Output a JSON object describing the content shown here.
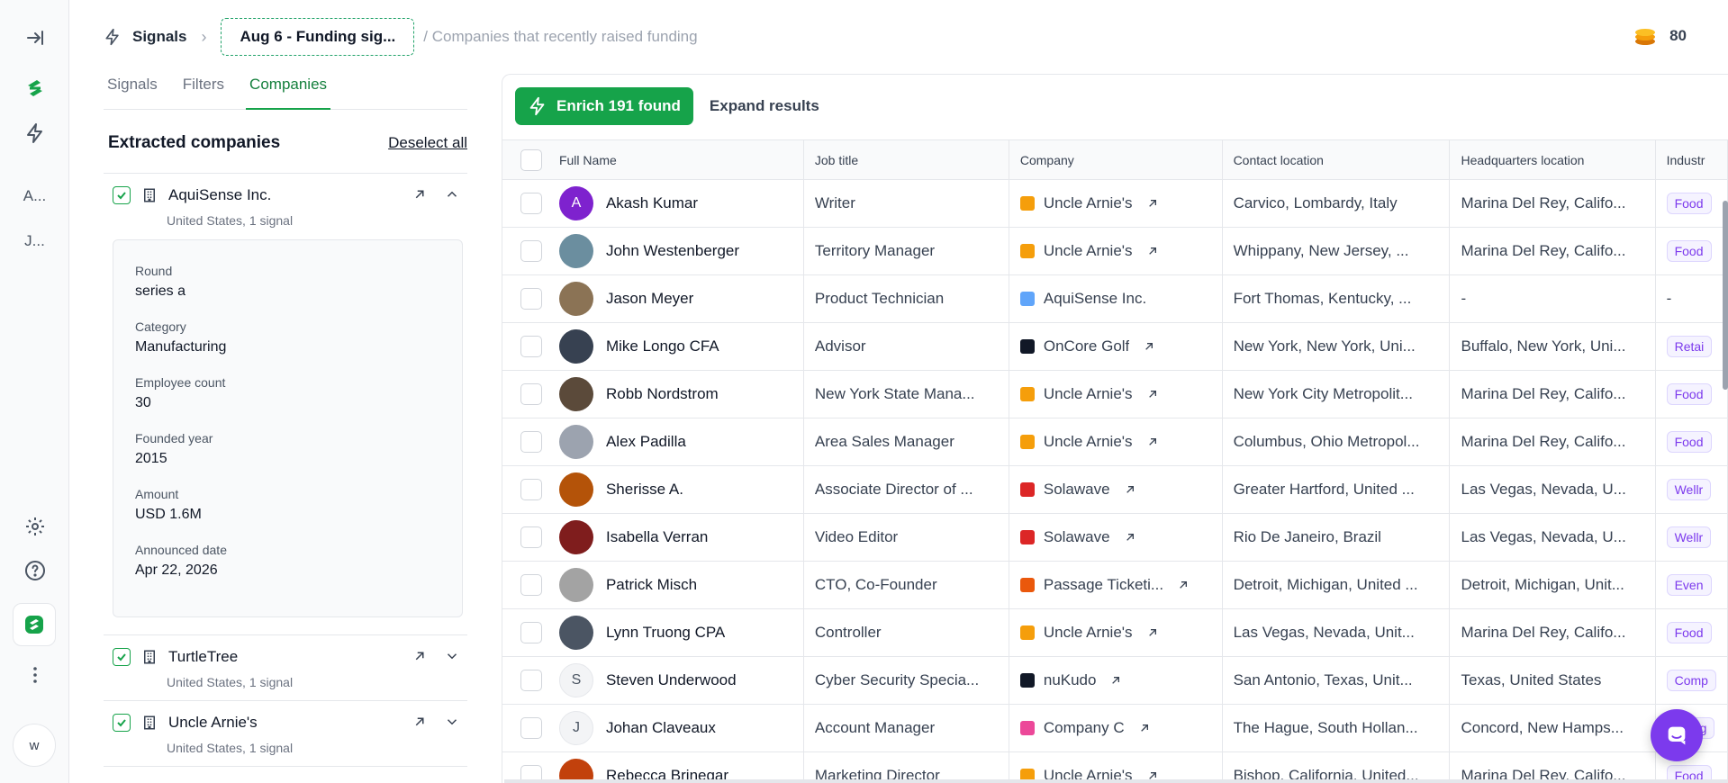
{
  "rail": {
    "letter_items": [
      "A...",
      "J..."
    ],
    "avatar_letter": "w"
  },
  "breadcrumb": {
    "root": "Signals",
    "current": "Aug 6 - Funding sig...",
    "description": "/ Companies that recently raised funding"
  },
  "credits": {
    "count": "80"
  },
  "left_tabs": [
    "Signals",
    "Filters",
    "Companies"
  ],
  "panel": {
    "title": "Extracted companies",
    "deselect_label": "Deselect all",
    "companies": [
      {
        "name": "AquiSense Inc.",
        "sub": "United States, 1 signal"
      },
      {
        "name": "TurtleTree",
        "sub": "United States, 1 signal"
      },
      {
        "name": "Uncle Arnie's",
        "sub": "United States, 1 signal"
      }
    ],
    "details": [
      {
        "label": "Round",
        "value": "series a"
      },
      {
        "label": "Category",
        "value": "Manufacturing"
      },
      {
        "label": "Employee count",
        "value": "30"
      },
      {
        "label": "Founded year",
        "value": "2015"
      },
      {
        "label": "Amount",
        "value": "USD 1.6M"
      },
      {
        "label": "Announced date",
        "value": "Apr 22, 2026"
      }
    ]
  },
  "toolbar": {
    "enrich_label": "Enrich 191 found",
    "expand_label": "Expand results"
  },
  "table": {
    "columns": [
      "Full Name",
      "Job title",
      "Company",
      "Contact location",
      "Headquarters location",
      "Industr"
    ],
    "rows": [
      {
        "name": "Akash Kumar",
        "avatar": "A",
        "title": "Writer",
        "company": "Uncle Arnie's",
        "link": true,
        "contact": "Carvico, Lombardy, Italy",
        "hq": "Marina Del Rey, Califo...",
        "industry": "Food"
      },
      {
        "name": "John Westenberger",
        "title": "Territory Manager",
        "company": "Uncle Arnie's",
        "link": true,
        "contact": "Whippany, New Jersey, ...",
        "hq": "Marina Del Rey, Califo...",
        "industry": "Food"
      },
      {
        "name": "Jason Meyer",
        "title": "Product Technician",
        "company": "AquiSense Inc.",
        "link": false,
        "contact": "Fort Thomas, Kentucky, ...",
        "hq": "-",
        "industry": "-"
      },
      {
        "name": "Mike Longo CFA",
        "title": "Advisor",
        "company": "OnCore Golf",
        "link": true,
        "contact": "New York, New York, Uni...",
        "hq": "Buffalo, New York, Uni...",
        "industry": "Retai"
      },
      {
        "name": "Robb Nordstrom",
        "title": "New York State Mana...",
        "company": "Uncle Arnie's",
        "link": true,
        "contact": "New York City Metropolit...",
        "hq": "Marina Del Rey, Califo...",
        "industry": "Food"
      },
      {
        "name": "Alex Padilla",
        "title": "Area Sales Manager",
        "company": "Uncle Arnie's",
        "link": true,
        "contact": "Columbus, Ohio Metropol...",
        "hq": "Marina Del Rey, Califo...",
        "industry": "Food"
      },
      {
        "name": "Sherisse A.",
        "title": "Associate Director of ...",
        "company": "Solawave",
        "link": true,
        "contact": "Greater Hartford, United ...",
        "hq": "Las Vegas, Nevada, U...",
        "industry": "Wellr"
      },
      {
        "name": "Isabella Verran",
        "title": "Video Editor",
        "company": "Solawave",
        "link": true,
        "contact": "Rio De Janeiro, Brazil",
        "hq": "Las Vegas, Nevada, U...",
        "industry": "Wellr"
      },
      {
        "name": "Patrick Misch",
        "title": "CTO, Co-Founder",
        "company": "Passage Ticketi...",
        "link": true,
        "contact": "Detroit, Michigan, United ...",
        "hq": "Detroit, Michigan, Unit...",
        "industry": "Even"
      },
      {
        "name": "Lynn Truong CPA",
        "title": "Controller",
        "company": "Uncle Arnie's",
        "link": true,
        "contact": "Las Vegas, Nevada, Unit...",
        "hq": "Marina Del Rey, Califo...",
        "industry": "Food"
      },
      {
        "name": "Steven Underwood",
        "avatar": "S",
        "title": "Cyber Security Specia...",
        "company": "nuKudo",
        "link": true,
        "contact": "San Antonio, Texas, Unit...",
        "hq": "Texas, United States",
        "industry": "Comp"
      },
      {
        "name": "Johan Claveaux",
        "avatar": "J",
        "title": "Account Manager",
        "company": "Company C",
        "link": true,
        "contact": "The Hague, South Hollan...",
        "hq": "Concord, New Hamps...",
        "industry": "Desig"
      },
      {
        "name": "Rebecca Brinegar",
        "title": "Marketing Director",
        "company": "Uncle Arnie's",
        "link": true,
        "contact": "Bishop, California, United...",
        "hq": "Marina Del Rey, Califo...",
        "industry": "Food"
      }
    ]
  },
  "colors": {
    "accent": "#16a34a",
    "chat": "#7c3aed",
    "tag_food": "#7c3aed"
  }
}
